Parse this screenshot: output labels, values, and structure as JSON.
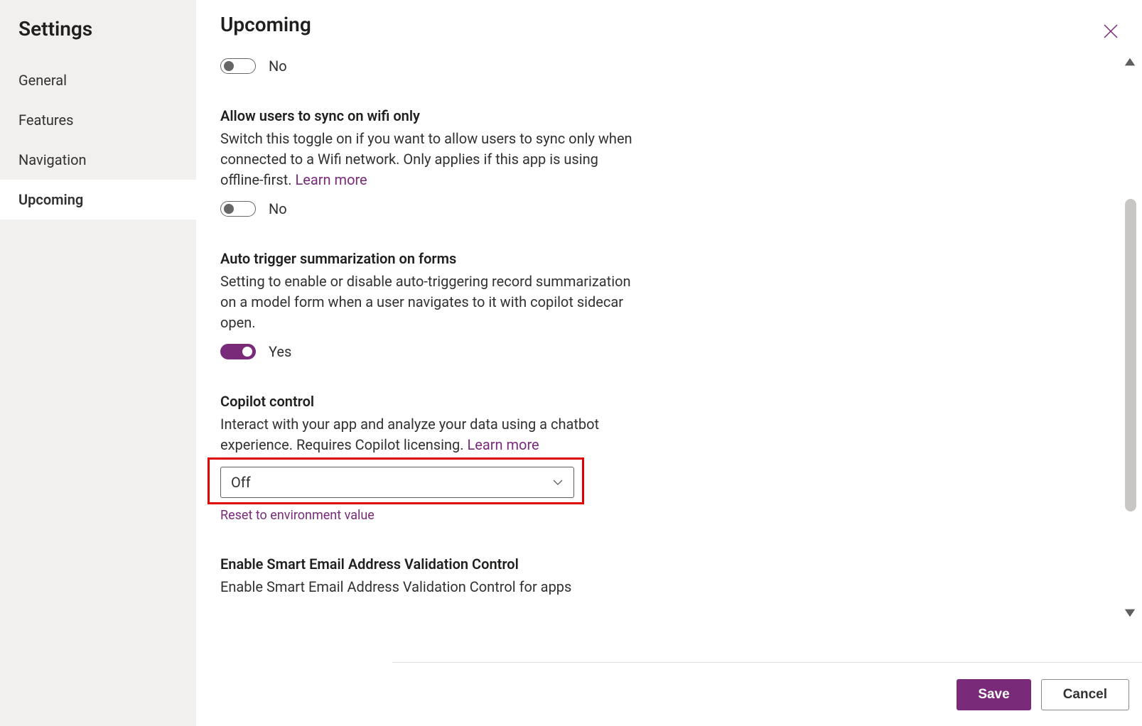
{
  "sidebar": {
    "title": "Settings",
    "items": [
      {
        "label": "General"
      },
      {
        "label": "Features"
      },
      {
        "label": "Navigation"
      },
      {
        "label": "Upcoming"
      }
    ],
    "activeIndex": 3
  },
  "page": {
    "title": "Upcoming"
  },
  "settings": {
    "orphan_toggle": {
      "state": "No"
    },
    "wifi_sync": {
      "title": "Allow users to sync on wifi only",
      "desc": "Switch this toggle on if you want to allow users to sync only when connected to a Wifi network. Only applies if this app is using offline-first. ",
      "learn_more": "Learn more",
      "state": "No"
    },
    "auto_summarize": {
      "title": "Auto trigger summarization on forms",
      "desc": "Setting to enable or disable auto-triggering record summarization on a model form when a user navigates to it with copilot sidecar open.",
      "state": "Yes"
    },
    "copilot": {
      "title": "Copilot control",
      "desc": "Interact with your app and analyze your data using a chatbot experience. Requires Copilot licensing. ",
      "learn_more": "Learn more",
      "selected": "Off",
      "reset": "Reset to environment value"
    },
    "smart_email": {
      "title": "Enable Smart Email Address Validation Control",
      "desc": "Enable Smart Email Address Validation Control for apps"
    }
  },
  "footer": {
    "save": "Save",
    "cancel": "Cancel"
  },
  "colors": {
    "accent": "#792b7a",
    "highlight": "#e00000"
  }
}
